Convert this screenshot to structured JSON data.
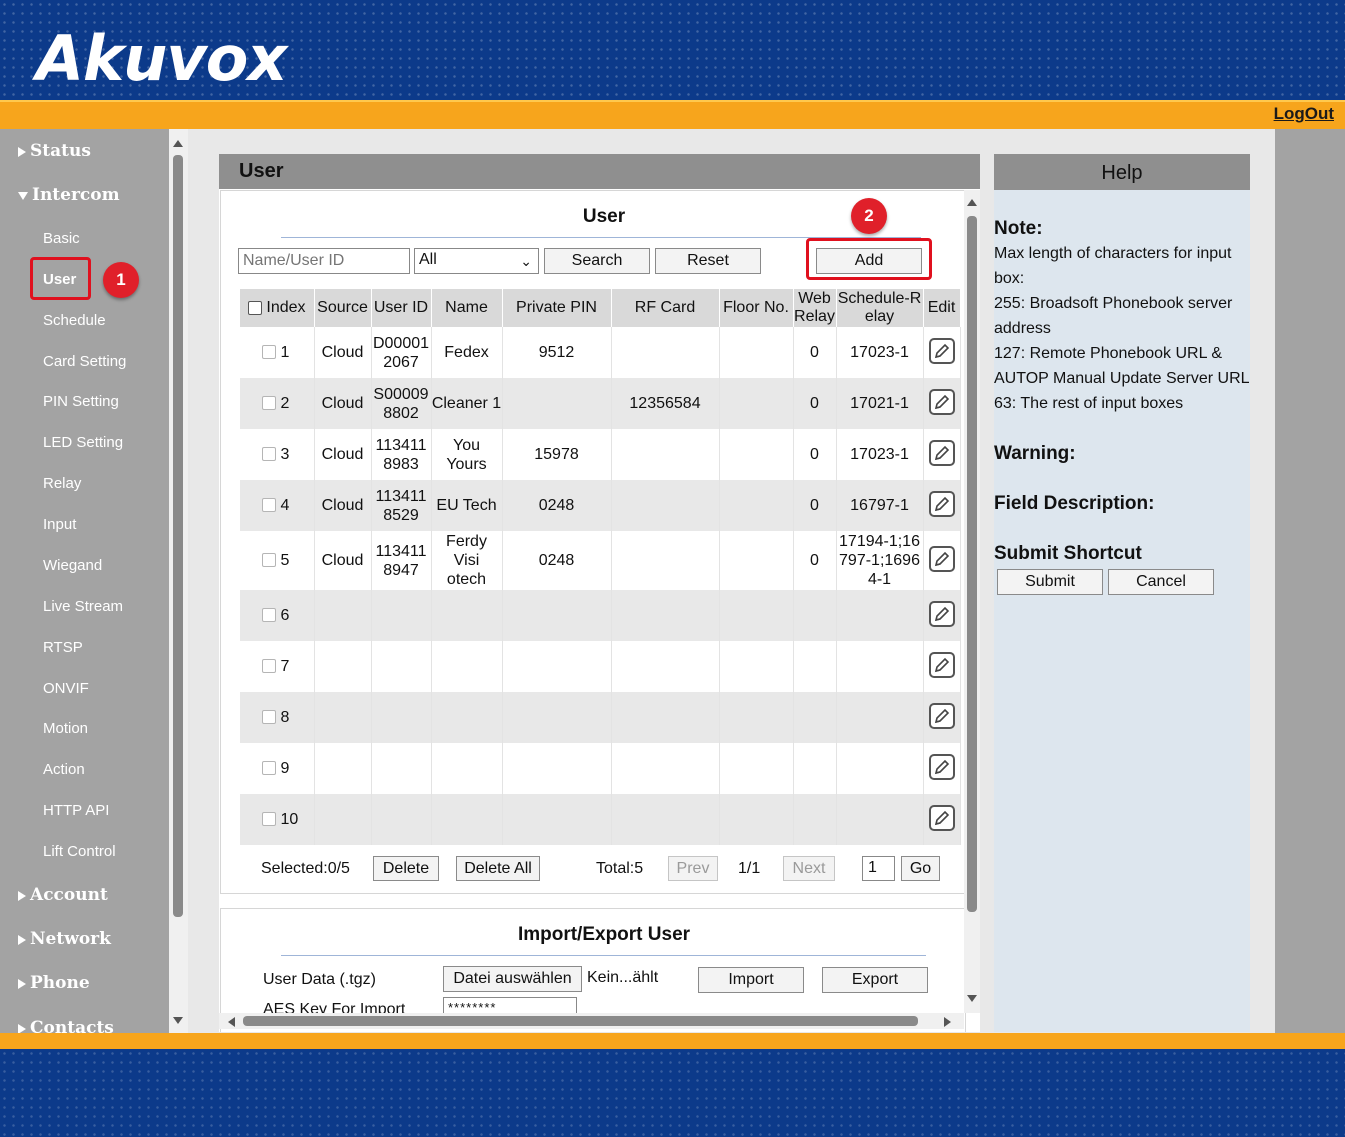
{
  "header": {
    "logo": "Akuvox",
    "logout": "LogOut"
  },
  "sidebar": {
    "main": [
      {
        "label": "Status",
        "state": "collapsed"
      },
      {
        "label": "Intercom",
        "state": "expanded"
      },
      {
        "label": "Account",
        "state": "collapsed"
      },
      {
        "label": "Network",
        "state": "collapsed"
      },
      {
        "label": "Phone",
        "state": "collapsed"
      },
      {
        "label": "Contacts",
        "state": "collapsed"
      }
    ],
    "sub": [
      "Basic",
      "User",
      "Schedule",
      "Card Setting",
      "PIN Setting",
      "LED Setting",
      "Relay",
      "Input",
      "Wiegand",
      "Live Stream",
      "RTSP",
      "ONVIF",
      "Motion",
      "Action",
      "HTTP API",
      "Lift Control"
    ],
    "active": "User"
  },
  "panel": {
    "title": "User",
    "section_title": "User",
    "search_placeholder": "Name/User ID",
    "filter_value": "All",
    "search_label": "Search",
    "reset_label": "Reset",
    "add_label": "Add"
  },
  "table": {
    "headers": [
      "Index",
      "Source",
      "User ID",
      "Name",
      "Private PIN",
      "RF Card",
      "Floor No.",
      "Web Relay",
      "Schedule-Relay",
      "Edit"
    ],
    "header_lines": {
      "web_relay": [
        "Web",
        "Relay"
      ],
      "schedule": [
        "Schedule-R",
        "elay"
      ]
    },
    "rows": [
      {
        "index": "1",
        "source": "Cloud",
        "userid": [
          "D00001",
          "2067"
        ],
        "name": [
          "Fedex"
        ],
        "pin": "9512",
        "card": "",
        "floor": "",
        "relay": "0",
        "schedule": [
          "17023-1"
        ]
      },
      {
        "index": "2",
        "source": "Cloud",
        "userid": [
          "S00009",
          "8802"
        ],
        "name": [
          "Cleaner 1"
        ],
        "pin": "",
        "card": "12356584",
        "floor": "",
        "relay": "0",
        "schedule": [
          "17021-1"
        ]
      },
      {
        "index": "3",
        "source": "Cloud",
        "userid": [
          "113411",
          "8983"
        ],
        "name": [
          "You Yours"
        ],
        "pin": "15978",
        "card": "",
        "floor": "",
        "relay": "0",
        "schedule": [
          "17023-1"
        ]
      },
      {
        "index": "4",
        "source": "Cloud",
        "userid": [
          "113411",
          "8529"
        ],
        "name": [
          "EU Tech"
        ],
        "pin": "0248",
        "card": "",
        "floor": "",
        "relay": "0",
        "schedule": [
          "16797-1"
        ]
      },
      {
        "index": "5",
        "source": "Cloud",
        "userid": [
          "113411",
          "8947"
        ],
        "name": [
          "Ferdy Visi",
          "otech"
        ],
        "pin": "0248",
        "card": "",
        "floor": "",
        "relay": "0",
        "schedule": [
          "17194-1;16",
          "797-1;1696",
          "4-1"
        ]
      },
      {
        "index": "6",
        "source": "",
        "userid": [],
        "name": [],
        "pin": "",
        "card": "",
        "floor": "",
        "relay": "",
        "schedule": []
      },
      {
        "index": "7",
        "source": "",
        "userid": [],
        "name": [],
        "pin": "",
        "card": "",
        "floor": "",
        "relay": "",
        "schedule": []
      },
      {
        "index": "8",
        "source": "",
        "userid": [],
        "name": [],
        "pin": "",
        "card": "",
        "floor": "",
        "relay": "",
        "schedule": []
      },
      {
        "index": "9",
        "source": "",
        "userid": [],
        "name": [],
        "pin": "",
        "card": "",
        "floor": "",
        "relay": "",
        "schedule": []
      },
      {
        "index": "10",
        "source": "",
        "userid": [],
        "name": [],
        "pin": "",
        "card": "",
        "floor": "",
        "relay": "",
        "schedule": []
      }
    ]
  },
  "pager": {
    "selected": "Selected:0/5",
    "delete_label": "Delete",
    "delete_all_label": "Delete All",
    "total": "Total:5",
    "prev_label": "Prev",
    "page": "1/1",
    "next_label": "Next",
    "page_input": "1",
    "go_label": "Go"
  },
  "import_export": {
    "title": "Import/Export User",
    "user_data_label": "User Data (.tgz)",
    "file_button": "Datei auswählen",
    "file_status": "Kein...ählt",
    "import_label": "Import",
    "export_label": "Export",
    "aes_label": "AES Key For Import",
    "aes_value": "********"
  },
  "help": {
    "title": "Help",
    "note_heading": "Note:",
    "note_lines": [
      "Max length of characters for input",
      "box:",
      "255: Broadsoft Phonebook server",
      "address",
      "127: Remote Phonebook URL &",
      "AUTOP Manual Update Server URL",
      "63: The rest of input boxes"
    ],
    "warning_heading": "Warning:",
    "field_heading": "Field Description:",
    "shortcut_heading": "Submit Shortcut",
    "submit_label": "Submit",
    "cancel_label": "Cancel"
  },
  "annotations": [
    "1",
    "2"
  ],
  "colors": {
    "header_blue": "#0c3a8a",
    "accent_orange": "#f7a51c",
    "sidebar_gray": "#a3a3a3",
    "highlight_red": "#e0101e"
  }
}
